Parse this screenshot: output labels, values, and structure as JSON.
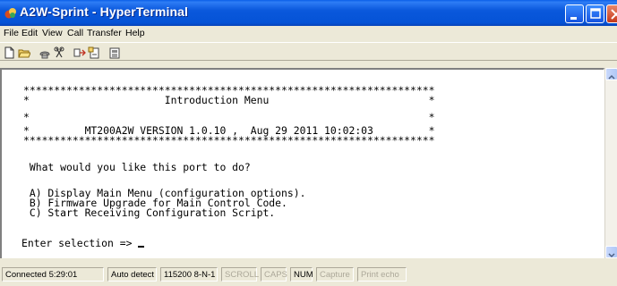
{
  "window": {
    "title": "A2W-Sprint - HyperTerminal",
    "app_icon": "hyperterminal-icon",
    "controls": {
      "minimize": "minimize-icon",
      "maximize": "maximize-icon",
      "close": "close-icon"
    }
  },
  "menubar": {
    "items": [
      "File",
      "Edit",
      "View",
      "Call",
      "Transfer",
      "Help"
    ]
  },
  "toolbar": {
    "items": [
      "new-icon",
      "open-icon",
      "call-icon",
      "disconnect-icon",
      "send-icon",
      "receive-icon",
      "properties-icon"
    ]
  },
  "terminal": {
    "lines": [
      "*******************************************************************",
      "*                      Introduction Menu                          *",
      "*                                                                 *",
      "*         MT200A2W VERSION 1.0.10 ,  Aug 29 2011 10:02:03         *",
      "*******************************************************************",
      "",
      " What would you like this port to do?",
      "",
      " A) Display Main Menu (configuration options).",
      " B) Firmware Upgrade for Main Control Code.",
      " C) Start Receiving Configuration Script.",
      "",
      "Enter selection => "
    ]
  },
  "statusbar": {
    "connected": "Connected 5:29:01",
    "detect": "Auto detect",
    "settings": "115200 8-N-1",
    "scroll": "SCROLL",
    "caps": "CAPS",
    "num": "NUM",
    "capture": "Capture",
    "print_echo": "Print echo"
  }
}
